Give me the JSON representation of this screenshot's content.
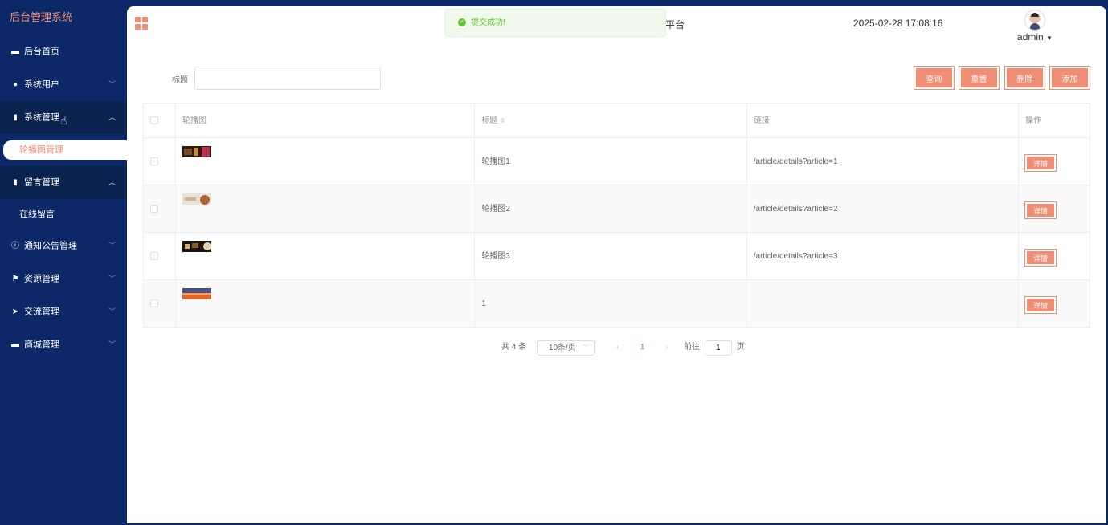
{
  "sidebar": {
    "brand": "后台管理系统",
    "items": [
      {
        "label": "后台首页",
        "icon": "monitor-icon"
      },
      {
        "label": "系统用户",
        "icon": "user-icon"
      },
      {
        "label": "系统管理",
        "icon": "bar-chart-icon",
        "sub": "轮播图管理"
      },
      {
        "label": "留言管理",
        "icon": "bar-chart-icon",
        "sub": "在线留言"
      },
      {
        "label": "通知公告管理",
        "icon": "info-icon"
      },
      {
        "label": "资源管理",
        "icon": "flag-icon"
      },
      {
        "label": "交流管理",
        "icon": "send-icon"
      },
      {
        "label": "商城管理",
        "icon": "device-icon"
      }
    ]
  },
  "header": {
    "platform_text": "平台",
    "datetime": "2025-02-28 17:08:16",
    "username": "admin"
  },
  "toast": {
    "message": "提交成功!"
  },
  "search": {
    "label": "标题",
    "value": "",
    "buttons": {
      "query": "查询",
      "reset": "重置",
      "delete": "删除",
      "add": "添加"
    }
  },
  "table": {
    "columns": [
      "轮播图",
      "标题",
      "链接",
      "操作"
    ],
    "rows": [
      {
        "title": "轮播图1",
        "link": "/article/details?article=1",
        "action": "详情"
      },
      {
        "title": "轮播图2",
        "link": "/article/details?article=2",
        "action": "详情"
      },
      {
        "title": "轮播图3",
        "link": "/article/details?article=3",
        "action": "详情"
      },
      {
        "title": "1",
        "link": "",
        "action": "详情"
      }
    ]
  },
  "pagination": {
    "total": "共 4 条",
    "page_size": "10条/页",
    "current_page": "1",
    "goto_prefix": "前往",
    "goto_value": "1",
    "goto_suffix": "页"
  },
  "colors": {
    "accent": "#f08d75",
    "sidebar_bg": "#0c2866",
    "success": "#67c23a"
  }
}
